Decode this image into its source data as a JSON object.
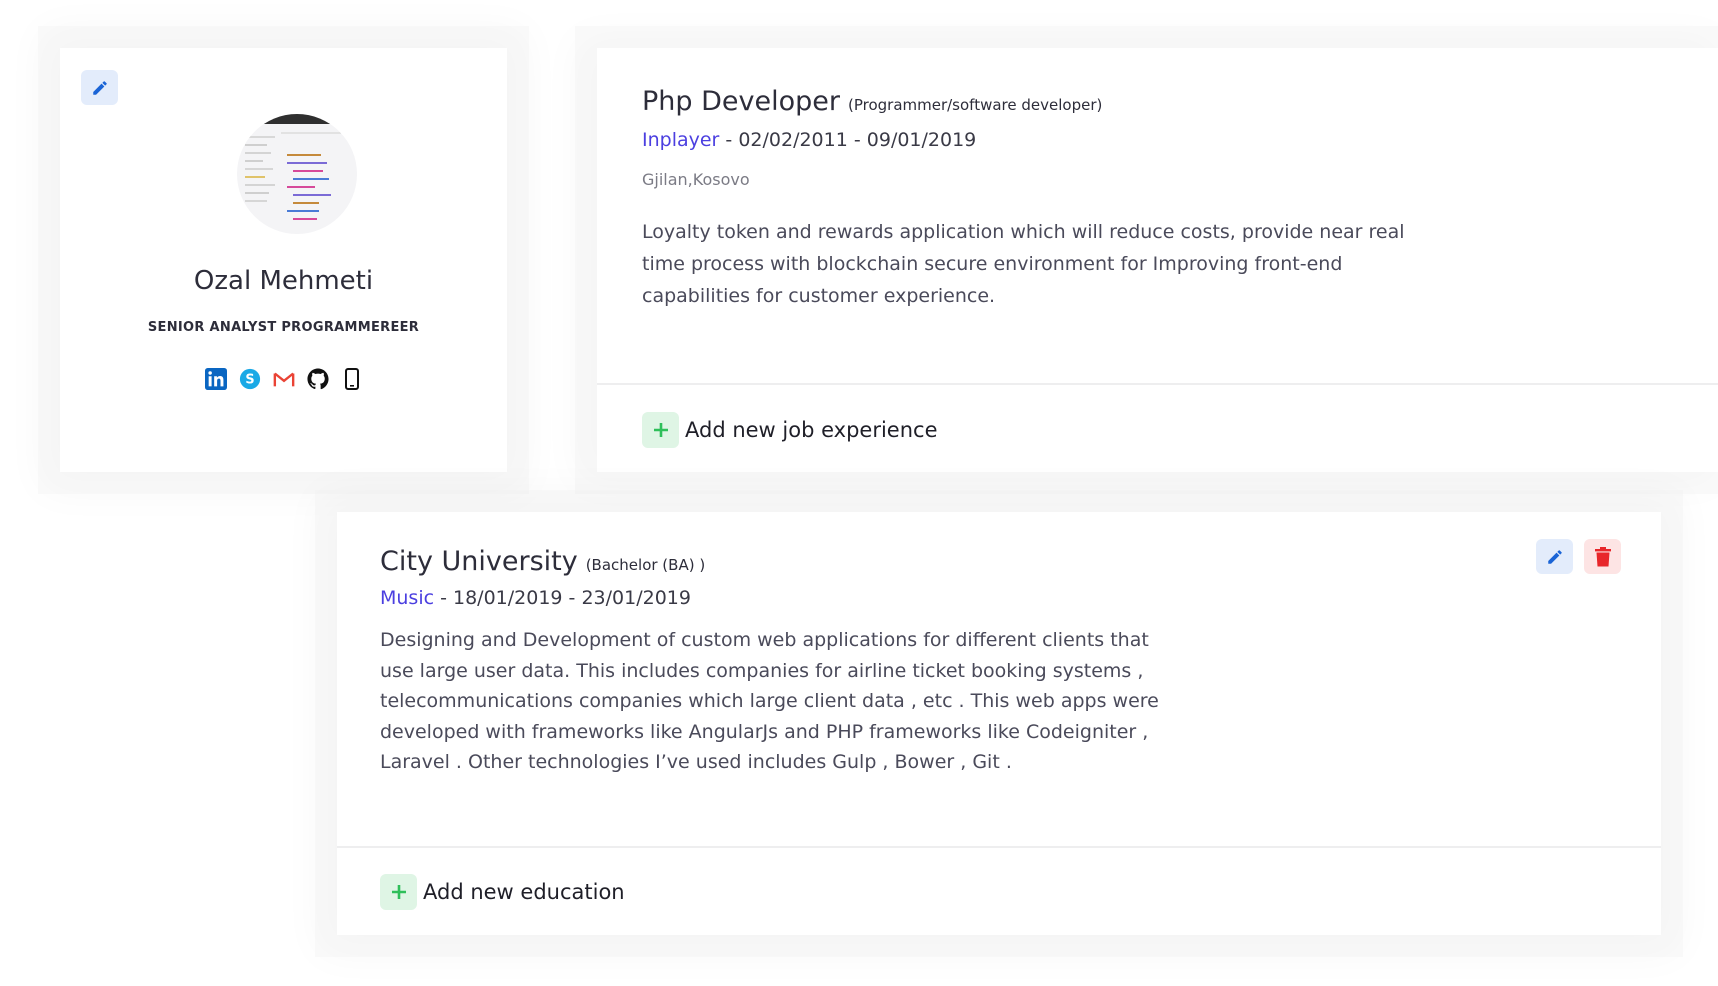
{
  "profile": {
    "name": "Ozal Mehmeti",
    "title": "SENIOR ANALYST PROGRAMMEREER",
    "socials": [
      "linkedin-icon",
      "skype-icon",
      "gmail-icon",
      "github-icon",
      "phone-icon"
    ]
  },
  "job": {
    "title": "Php Developer",
    "subtitle": "(Programmer/software developer)",
    "company": "Inplayer",
    "dates": "- 02/02/2011 - 09/01/2019",
    "location": "Gjilan,Kosovo",
    "description": "Loyalty token and rewards application which will reduce costs, provide near real time process with blockchain secure environment for Improving front-end capabilities for customer experience.",
    "add_label": "Add new job experience"
  },
  "education": {
    "title": "City University",
    "subtitle": "(Bachelor (BA) )",
    "field": "Music",
    "dates": "- 18/01/2019 - 23/01/2019",
    "description": "Designing and Development of custom web applications for different clients that use large user data. This includes companies for airline ticket booking systems , telecommunications companies which large client data , etc . This web apps were developed with frameworks like AngularJs and PHP frameworks like Codeigniter , Laravel . Other technologies I’ve used includes Gulp , Bower , Git .",
    "add_label": "Add new education"
  },
  "colors": {
    "accent": "#4b3fe0",
    "edit_blue": "#1a64d6",
    "delete_red": "#e8262a",
    "add_green": "#2fbf5a"
  }
}
